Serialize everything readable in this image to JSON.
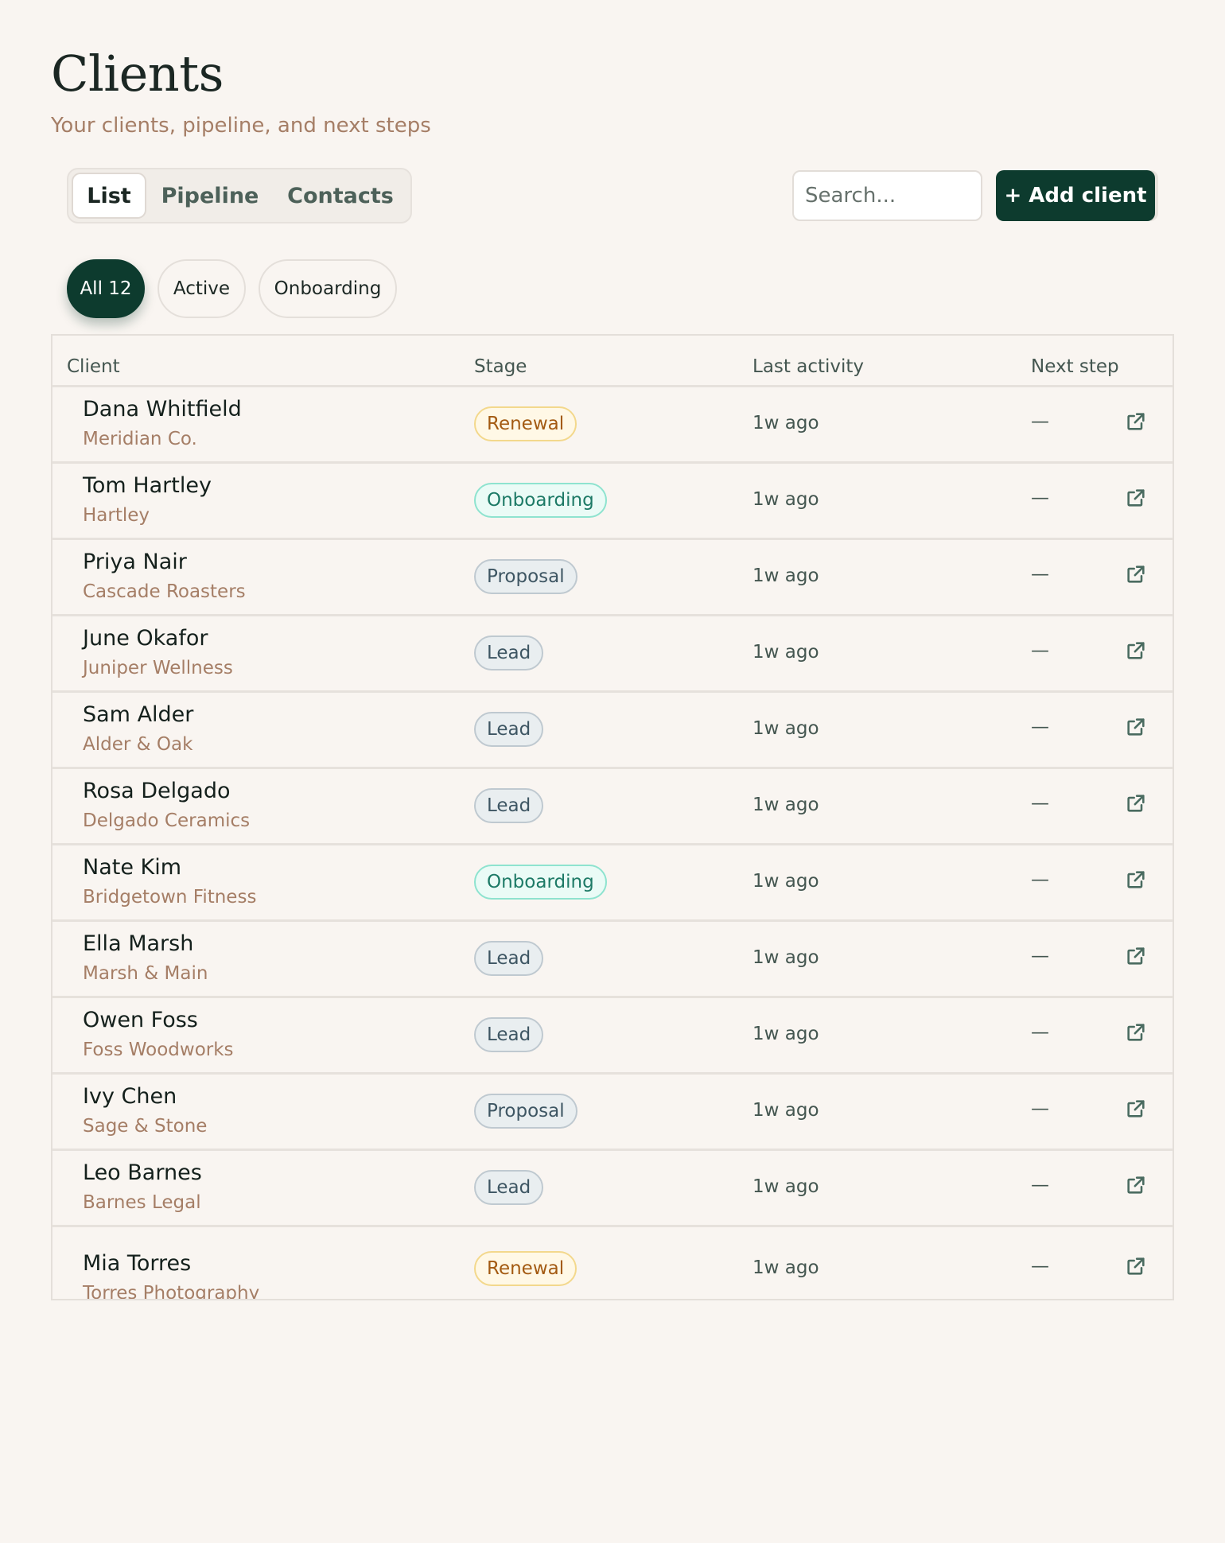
{
  "page": {
    "title": "Clients",
    "subtitle": "Your clients, pipeline, and next steps"
  },
  "tabs": [
    "List",
    "Pipeline",
    "Contacts"
  ],
  "search": {
    "placeholder": "Search..."
  },
  "add_button": {
    "label": "+ Add client"
  },
  "filters": [
    "All 12",
    "Active",
    "Onboarding"
  ],
  "table": {
    "columns": [
      "Client",
      "Stage",
      "Last activity",
      "Next step"
    ],
    "rows": [
      {
        "name": "Dana Whitfield",
        "company": "Meridian Co.",
        "stage": "Renewal",
        "activity": "1w ago",
        "next": "—"
      },
      {
        "name": "Tom Hartley",
        "company": "Hartley",
        "stage": "Onboarding",
        "activity": "1w ago",
        "next": "—"
      },
      {
        "name": "Priya Nair",
        "company": "Cascade Roasters",
        "stage": "Proposal",
        "activity": "1w ago",
        "next": "—"
      },
      {
        "name": "June Okafor",
        "company": "Juniper Wellness",
        "stage": "Lead",
        "activity": "1w ago",
        "next": "—"
      },
      {
        "name": "Sam Alder",
        "company": "Alder & Oak",
        "stage": "Lead",
        "activity": "1w ago",
        "next": "—"
      },
      {
        "name": "Rosa Delgado",
        "company": "Delgado Ceramics",
        "stage": "Lead",
        "activity": "1w ago",
        "next": "—"
      },
      {
        "name": "Nate Kim",
        "company": "Bridgetown Fitness",
        "stage": "Onboarding",
        "activity": "1w ago",
        "next": "—"
      },
      {
        "name": "Ella Marsh",
        "company": "Marsh & Main",
        "stage": "Lead",
        "activity": "1w ago",
        "next": "—"
      },
      {
        "name": "Owen Foss",
        "company": "Foss Woodworks",
        "stage": "Lead",
        "activity": "1w ago",
        "next": "—"
      },
      {
        "name": "Ivy Chen",
        "company": "Sage & Stone",
        "stage": "Proposal",
        "activity": "1w ago",
        "next": "—"
      },
      {
        "name": "Leo Barnes",
        "company": "Barnes Legal",
        "stage": "Lead",
        "activity": "1w ago",
        "next": "—"
      },
      {
        "name": "Mia Torres",
        "company": "Torres Photography",
        "stage": "Renewal",
        "activity": "1w ago",
        "next": "—"
      }
    ]
  },
  "icons": {
    "row_action": "external-link-icon"
  },
  "colors": {
    "background": "#f9f5f1",
    "primary": "#0d3b2e",
    "subtitle": "#a57e66",
    "renewal": "#a35a12",
    "onboarding": "#1d7a66",
    "lead_proposal": "#3e5663"
  }
}
